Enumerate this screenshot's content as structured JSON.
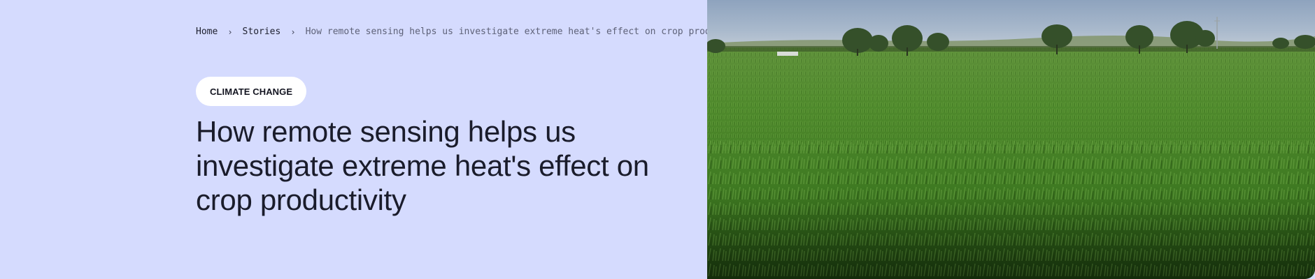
{
  "breadcrumb": {
    "home": "Home",
    "stories": "Stories",
    "separator": "›",
    "current": "How remote sensing helps us investigate extreme heat's effect on crop productivity"
  },
  "tag": {
    "label": "CLIMATE CHANGE"
  },
  "article": {
    "title": "How remote sensing helps us investigate extreme heat's effect on crop productivity"
  },
  "colors": {
    "background": "#d5dbfe",
    "text": "#1a1c2b",
    "tag_background": "#ffffff"
  },
  "hero_image": {
    "icon": "crop-field-photo"
  }
}
